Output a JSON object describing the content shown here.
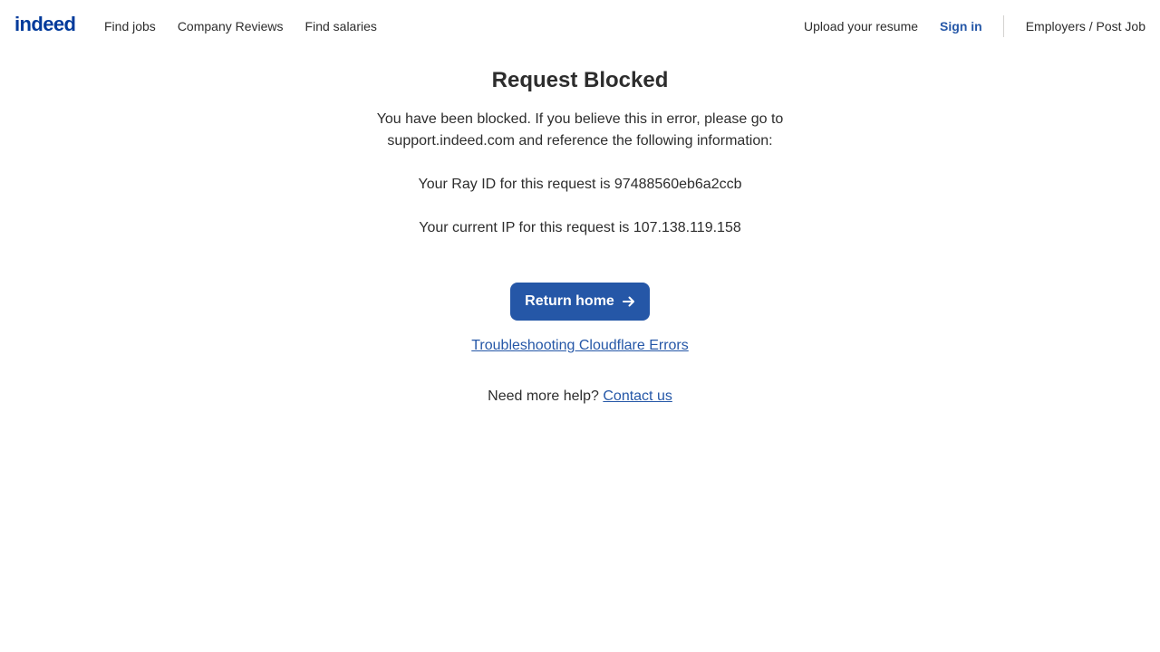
{
  "header": {
    "logo_text": "indeed",
    "logo_color": "#003a9b",
    "nav_left": [
      "Find jobs",
      "Company Reviews",
      "Find salaries"
    ],
    "upload_resume": "Upload your resume",
    "sign_in": "Sign in",
    "employers": "Employers / Post Job"
  },
  "main": {
    "title": "Request Blocked",
    "message": "You have been blocked. If you believe this in error, please go to support.indeed.com and reference the following information:",
    "ray_id_line": "Your Ray ID for this request is 97488560eb6a2ccb",
    "ip_line": "Your current IP for this request is 107.138.119.158",
    "return_home_label": "Return home",
    "return_home_icon": "arrow-right-icon",
    "troubleshooting_link": "Troubleshooting Cloudflare Errors",
    "help_text": "Need more help?",
    "contact_link": "Contact us"
  },
  "colors": {
    "accent": "#2557a7",
    "text": "#2d2d2d",
    "divider": "#d4d2d0"
  }
}
